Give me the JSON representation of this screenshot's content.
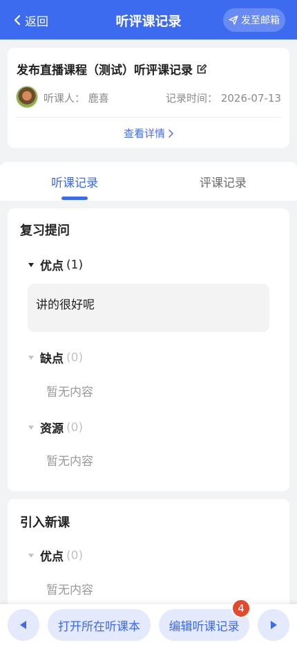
{
  "header": {
    "back_label": "返回",
    "title": "听评课记录",
    "mail_label": "发至邮箱"
  },
  "course": {
    "title": "发布直播课程（测试）听评课记录",
    "listener": "听课人：  鹿喜",
    "record_time": "记录时间：  2026-07-13",
    "details_label": "查看详情"
  },
  "tabs": [
    {
      "label": "听课记录",
      "active": true
    },
    {
      "label": "评课记录",
      "active": false
    }
  ],
  "sections": [
    {
      "title": "复习提问",
      "groups": [
        {
          "label": "优点",
          "count": "(1)",
          "content": "讲的很好呢"
        },
        {
          "label": "缺点",
          "count": "(0)",
          "empty_text": "暂无内容"
        },
        {
          "label": "资源",
          "count": "(0)",
          "empty_text": "暂无内容"
        }
      ]
    },
    {
      "title": "引入新课",
      "groups": [
        {
          "label": "优点",
          "count": "(0)",
          "empty_text": "暂无内容"
        }
      ]
    }
  ],
  "bottom": {
    "open_notebook_label": "打开所在听课本",
    "edit_record_label": "编辑听课记录",
    "badge_count": "4"
  },
  "colors": {
    "accent": "#3d6bf0",
    "badge": "#e24a2e"
  }
}
